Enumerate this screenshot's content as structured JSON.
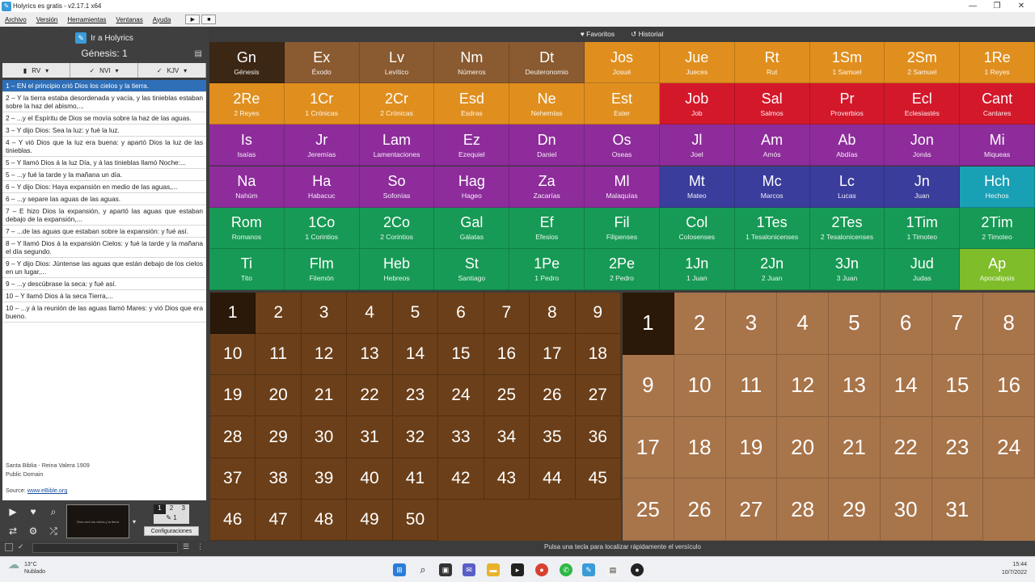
{
  "window": {
    "title": "Holyrics es gratis - v2.17.1 x64",
    "minimize": "—",
    "maximize": "❐",
    "close": "✕"
  },
  "menu": [
    "Archivo",
    "Versión",
    "Herramientas",
    "Ventanas",
    "Ayuda"
  ],
  "toolbar": {
    "play": "▶",
    "stop": "■"
  },
  "left": {
    "goto_label": "Ir a Holyrics",
    "current_ref": "Génesis: 1",
    "version_tabs": [
      {
        "label": "RV",
        "check": ""
      },
      {
        "label": "NVI",
        "check": "✓"
      },
      {
        "label": "KJV",
        "check": "✓"
      }
    ],
    "verses": [
      "1 – EN el principio crió Dios los cielos y la tierra.",
      "2 – Y la tierra estaba desordenada y vacía, y las tinieblas estaban sobre la haz del abismo,...",
      "2 – ...y el Espíritu de Dios se movía sobre la haz de las aguas.",
      "3 – Y dijo Dios: Sea la luz: y fué la luz.",
      "4 – Y vió Dios que la luz era buena: y apartó Dios la luz de las tinieblas.",
      "5 – Y llamó Dios á la luz Día, y á las tinieblas llamó Noche:...",
      "5 – ...y fué la tarde y la mañana un día.",
      "6 – Y dijo Dios: Haya expansión en medio de las aguas,...",
      "6 – ...y separe las aguas de las aguas.",
      "7 – E hizo Dios la expansión, y apartó las aguas que estaban debajo de la expansión,...",
      "7 – ...de las aguas que estaban sobre la expansión: y fué así.",
      "8 – Y llamó Dios á la expansión Cielos: y fué la tarde y la mañana el día segundo.",
      "9 – Y dijo Dios: Júntense las aguas que están debajo de los cielos en un lugar,...",
      "9 – ...y descúbrase la seca: y fué así.",
      "10 – Y llamó Dios á la seca Tierra,...",
      "10 – ...y á la reunión de las aguas llamó Mares: y vió Dios que era bueno."
    ],
    "credit": {
      "line1": "Santa Biblia - Reina Valera 1909",
      "line2": "Public Domain",
      "source_label": "Source:",
      "source_link": "www.eBible.org"
    },
    "config_label": "Configuraciones",
    "page_numbers": [
      "1",
      "2",
      "3"
    ],
    "thumb_text": "Dios creó los cielos y la tierra"
  },
  "topbar": {
    "favorites": "Favoritos",
    "history": "Historial"
  },
  "books": [
    {
      "ab": "Gn",
      "name": "Génesis",
      "color": "#3b2714"
    },
    {
      "ab": "Ex",
      "name": "Éxodo",
      "color": "#8a5a30"
    },
    {
      "ab": "Lv",
      "name": "Levítico",
      "color": "#8a5a30"
    },
    {
      "ab": "Nm",
      "name": "Números",
      "color": "#8a5a30"
    },
    {
      "ab": "Dt",
      "name": "Deuteronomio",
      "color": "#8a5a30"
    },
    {
      "ab": "Jos",
      "name": "Josué",
      "color": "#e08f1e"
    },
    {
      "ab": "Jue",
      "name": "Jueces",
      "color": "#e08f1e"
    },
    {
      "ab": "Rt",
      "name": "Rut",
      "color": "#e08f1e"
    },
    {
      "ab": "1Sm",
      "name": "1 Samuel",
      "color": "#e08f1e"
    },
    {
      "ab": "2Sm",
      "name": "2 Samuel",
      "color": "#e08f1e"
    },
    {
      "ab": "1Re",
      "name": "1 Reyes",
      "color": "#e08f1e"
    },
    {
      "ab": "2Re",
      "name": "2 Reyes",
      "color": "#e08f1e"
    },
    {
      "ab": "1Cr",
      "name": "1 Crónicas",
      "color": "#e08f1e"
    },
    {
      "ab": "2Cr",
      "name": "2 Crónicas",
      "color": "#e08f1e"
    },
    {
      "ab": "Esd",
      "name": "Esdras",
      "color": "#e08f1e"
    },
    {
      "ab": "Ne",
      "name": "Nehemías",
      "color": "#e08f1e"
    },
    {
      "ab": "Est",
      "name": "Ester",
      "color": "#e08f1e"
    },
    {
      "ab": "Job",
      "name": "Job",
      "color": "#d3182a"
    },
    {
      "ab": "Sal",
      "name": "Salmos",
      "color": "#d3182a"
    },
    {
      "ab": "Pr",
      "name": "Proverbios",
      "color": "#d3182a"
    },
    {
      "ab": "Ecl",
      "name": "Eclesiastés",
      "color": "#d3182a"
    },
    {
      "ab": "Cant",
      "name": "Cantares",
      "color": "#d3182a"
    },
    {
      "ab": "Is",
      "name": "Isaías",
      "color": "#8e2c9c"
    },
    {
      "ab": "Jr",
      "name": "Jeremías",
      "color": "#8e2c9c"
    },
    {
      "ab": "Lam",
      "name": "Lamentaciones",
      "color": "#8e2c9c"
    },
    {
      "ab": "Ez",
      "name": "Ezequiel",
      "color": "#8e2c9c"
    },
    {
      "ab": "Dn",
      "name": "Daniel",
      "color": "#8e2c9c"
    },
    {
      "ab": "Os",
      "name": "Oseas",
      "color": "#8e2c9c"
    },
    {
      "ab": "Jl",
      "name": "Joel",
      "color": "#8e2c9c"
    },
    {
      "ab": "Am",
      "name": "Amós",
      "color": "#8e2c9c"
    },
    {
      "ab": "Ab",
      "name": "Abdías",
      "color": "#8e2c9c"
    },
    {
      "ab": "Jon",
      "name": "Jonás",
      "color": "#8e2c9c"
    },
    {
      "ab": "Mi",
      "name": "Miqueas",
      "color": "#8e2c9c"
    },
    {
      "ab": "Na",
      "name": "Nahúm",
      "color": "#8e2c9c"
    },
    {
      "ab": "Ha",
      "name": "Habacuc",
      "color": "#8e2c9c"
    },
    {
      "ab": "So",
      "name": "Sofonías",
      "color": "#8e2c9c"
    },
    {
      "ab": "Hag",
      "name": "Hageo",
      "color": "#8e2c9c"
    },
    {
      "ab": "Za",
      "name": "Zacarías",
      "color": "#8e2c9c"
    },
    {
      "ab": "Ml",
      "name": "Malaquías",
      "color": "#8e2c9c"
    },
    {
      "ab": "Mt",
      "name": "Mateo",
      "color": "#3a3d9c"
    },
    {
      "ab": "Mc",
      "name": "Marcos",
      "color": "#3a3d9c"
    },
    {
      "ab": "Lc",
      "name": "Lucas",
      "color": "#3a3d9c"
    },
    {
      "ab": "Jn",
      "name": "Juan",
      "color": "#3a3d9c"
    },
    {
      "ab": "Hch",
      "name": "Hechos",
      "color": "#1aa0b5"
    },
    {
      "ab": "Rom",
      "name": "Romanos",
      "color": "#179a55"
    },
    {
      "ab": "1Co",
      "name": "1 Corintios",
      "color": "#179a55"
    },
    {
      "ab": "2Co",
      "name": "2 Corintios",
      "color": "#179a55"
    },
    {
      "ab": "Gal",
      "name": "Gálatas",
      "color": "#179a55"
    },
    {
      "ab": "Ef",
      "name": "Efesios",
      "color": "#179a55"
    },
    {
      "ab": "Fil",
      "name": "Filipenses",
      "color": "#179a55"
    },
    {
      "ab": "Col",
      "name": "Colosenses",
      "color": "#179a55"
    },
    {
      "ab": "1Tes",
      "name": "1 Tesalonicenses",
      "color": "#179a55"
    },
    {
      "ab": "2Tes",
      "name": "2 Tesalonicenses",
      "color": "#179a55"
    },
    {
      "ab": "1Tim",
      "name": "1 Timoteo",
      "color": "#179a55"
    },
    {
      "ab": "2Tim",
      "name": "2 Timoteo",
      "color": "#179a55"
    },
    {
      "ab": "Ti",
      "name": "Tito",
      "color": "#179a55"
    },
    {
      "ab": "Flm",
      "name": "Filemón",
      "color": "#179a55"
    },
    {
      "ab": "Heb",
      "name": "Hebreos",
      "color": "#179a55"
    },
    {
      "ab": "St",
      "name": "Santiago",
      "color": "#179a55"
    },
    {
      "ab": "1Pe",
      "name": "1 Pedro",
      "color": "#179a55"
    },
    {
      "ab": "2Pe",
      "name": "2 Pedro",
      "color": "#179a55"
    },
    {
      "ab": "1Jn",
      "name": "1 Juan",
      "color": "#179a55"
    },
    {
      "ab": "2Jn",
      "name": "2 Juan",
      "color": "#179a55"
    },
    {
      "ab": "3Jn",
      "name": "3 Juan",
      "color": "#179a55"
    },
    {
      "ab": "Jud",
      "name": "Judas",
      "color": "#179a55"
    },
    {
      "ab": "Ap",
      "name": "Apocalipsis",
      "color": "#7fbd2a"
    }
  ],
  "chapters": {
    "count": 50,
    "selected": "1",
    "selected_color": "#2a1808"
  },
  "verses_grid": {
    "count": 31,
    "selected": "1",
    "selected_color": "#2a1808"
  },
  "hint": "Pulsa una tecla para localizar rápidamente el versículo",
  "taskbar": {
    "temp": "13°C",
    "weather": "Nublado",
    "time": "15:44",
    "date": "10/7/2022"
  }
}
